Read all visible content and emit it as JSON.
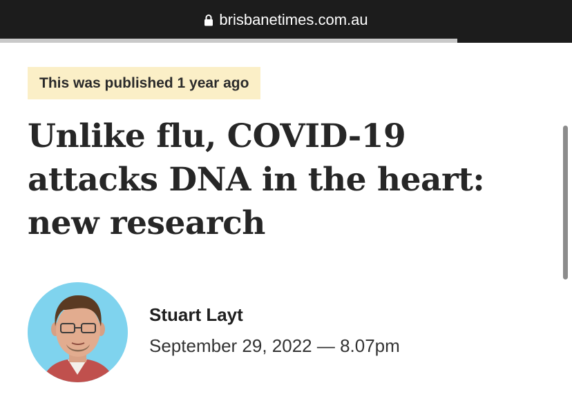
{
  "browser": {
    "url": "brisbanetimes.com.au",
    "lock_icon": "lock-icon",
    "load_progress": 0.8
  },
  "article": {
    "badge": "This was published 1 year ago",
    "headline": "Unlike flu, COVID-19 attacks DNA in the heart: new research",
    "author": "Stuart Layt",
    "date": "September 29, 2022",
    "separator": " — ",
    "time": "8.07pm",
    "avatar_bg": "#7fd3ee"
  },
  "colors": {
    "badge_bg": "#fbefc7",
    "urlbar_bg": "#1c1c1c"
  }
}
